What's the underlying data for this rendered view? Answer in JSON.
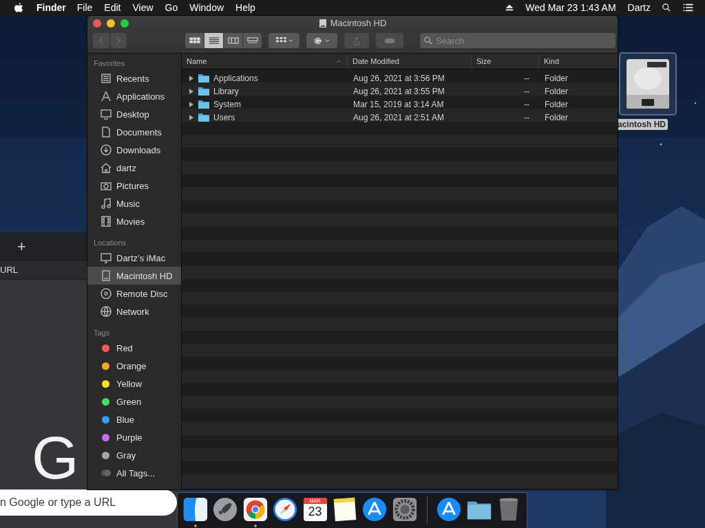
{
  "menubar": {
    "app": "Finder",
    "menus": [
      "File",
      "Edit",
      "View",
      "Go",
      "Window",
      "Help"
    ],
    "clock": "Wed Mar 23  1:43 AM",
    "user": "Dartz"
  },
  "background_browser": {
    "new_tab": "+",
    "address_text": "URL",
    "logo": "G",
    "omnibox_placeholder": "n Google or type a URL"
  },
  "desktop_icon": {
    "label": "acintosh HD",
    "selected": true
  },
  "finder": {
    "title": "Macintosh HD",
    "back_enabled": false,
    "forward_enabled": false,
    "view_buttons": [
      {
        "selected": false
      },
      {
        "selected": true
      },
      {
        "selected": false
      },
      {
        "selected": false
      }
    ],
    "search": {
      "placeholder": "Search"
    },
    "sidebar": [
      {
        "heading": "Favorites",
        "items": [
          {
            "label": "Recents",
            "selected": false
          },
          {
            "label": "Applications",
            "selected": false
          },
          {
            "label": "Desktop",
            "selected": false
          },
          {
            "label": "Documents",
            "selected": false
          },
          {
            "label": "Downloads",
            "selected": false
          },
          {
            "label": "dartz",
            "selected": false
          },
          {
            "label": "Pictures",
            "selected": false
          },
          {
            "label": "Music",
            "selected": false
          },
          {
            "label": "Movies",
            "selected": false
          }
        ]
      },
      {
        "heading": "Locations",
        "items": [
          {
            "label": "Dartz’s iMac",
            "selected": false
          },
          {
            "label": "Macintosh HD",
            "selected": true
          },
          {
            "label": "Remote Disc",
            "selected": false
          },
          {
            "label": "Network",
            "selected": false
          }
        ]
      },
      {
        "heading": "Tags",
        "items": [
          {
            "label": "Red",
            "kind": "tag",
            "color": "#f05a5a",
            "selected": false
          },
          {
            "label": "Orange",
            "kind": "tag",
            "color": "#f5a623",
            "selected": false
          },
          {
            "label": "Yellow",
            "kind": "tag",
            "color": "#f8e12c",
            "selected": false
          },
          {
            "label": "Green",
            "kind": "tag",
            "color": "#4cd964",
            "selected": false
          },
          {
            "label": "Blue",
            "kind": "tag",
            "color": "#3b99fc",
            "selected": false
          },
          {
            "label": "Purple",
            "kind": "tag",
            "color": "#c86cf0",
            "selected": false
          },
          {
            "label": "Gray",
            "kind": "tag",
            "color": "#a5a5a5",
            "selected": false
          },
          {
            "label": "All Tags...",
            "kind": "all",
            "selected": false
          }
        ]
      }
    ],
    "columns": [
      {
        "label": "Name",
        "sorted": true
      },
      {
        "label": "Date Modified",
        "sorted": false
      },
      {
        "label": "Size",
        "sorted": false
      },
      {
        "label": "Kind",
        "sorted": false
      }
    ],
    "rows": [
      {
        "name": "Applications",
        "date": "Aug 26, 2021 at 3:56 PM",
        "size": "--",
        "kind": "Folder",
        "expanded": false
      },
      {
        "name": "Library",
        "date": "Aug 26, 2021 at 3:55 PM",
        "size": "--",
        "kind": "Folder",
        "expanded": false
      },
      {
        "name": "System",
        "date": "Mar 15, 2019 at 3:14 AM",
        "size": "--",
        "kind": "Folder",
        "expanded": false
      },
      {
        "name": "Users",
        "date": "Aug 26, 2021 at 2:51 AM",
        "size": "--",
        "kind": "Folder",
        "expanded": false
      }
    ]
  },
  "dock": {
    "items": [
      {
        "kind": "finder",
        "running": true
      },
      {
        "kind": "launchpad",
        "running": false
      },
      {
        "kind": "chrome",
        "running": true
      },
      {
        "kind": "safari",
        "running": false
      },
      {
        "kind": "calendar",
        "running": false,
        "month": "MAR",
        "day": "23"
      },
      {
        "kind": "notes",
        "running": false
      },
      {
        "kind": "appstore",
        "running": false
      },
      {
        "kind": "settings",
        "running": false
      },
      {
        "kind": "separator"
      },
      {
        "kind": "appstore",
        "running": false
      },
      {
        "kind": "folder",
        "running": false
      },
      {
        "kind": "trash",
        "running": false
      }
    ]
  }
}
